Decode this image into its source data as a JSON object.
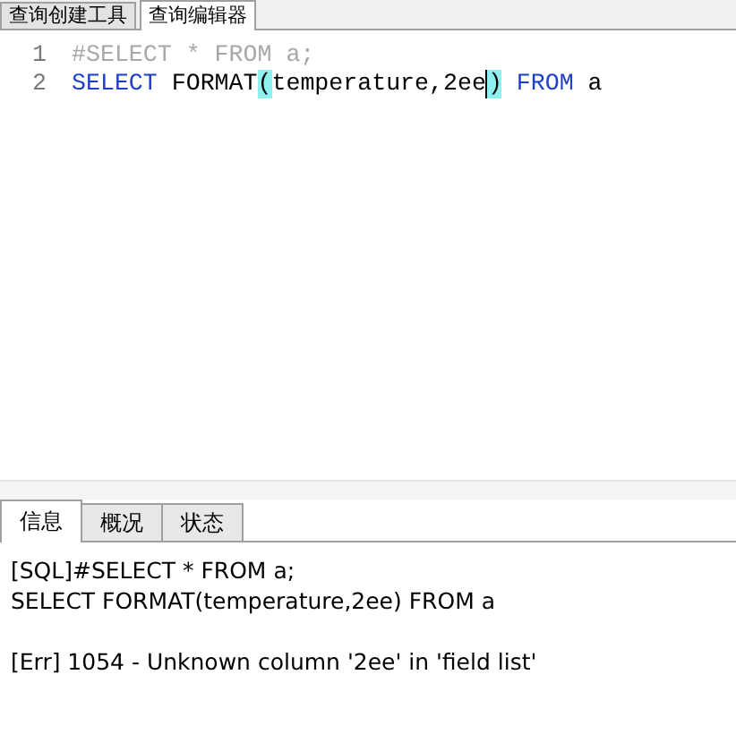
{
  "top_tabs": [
    {
      "label": "查询创建工具",
      "selected": false
    },
    {
      "label": "查询编辑器",
      "selected": true
    }
  ],
  "editor": {
    "lines": [
      {
        "number": "1",
        "tokens": [
          {
            "kind": "comment",
            "text": "#SELECT * FROM a;"
          }
        ]
      },
      {
        "number": "2",
        "tokens": [
          {
            "kind": "keyword",
            "text": "SELECT"
          },
          {
            "kind": "plain",
            "text": " FORMAT"
          },
          {
            "kind": "bracket_match",
            "text": "("
          },
          {
            "kind": "plain",
            "text": "temperature,2ee"
          },
          {
            "kind": "cursor"
          },
          {
            "kind": "bracket_match",
            "text": ")"
          },
          {
            "kind": "keyword",
            "text": " FROM"
          },
          {
            "kind": "plain",
            "text": " a"
          }
        ]
      }
    ]
  },
  "bottom_tabs": [
    {
      "label": "信息",
      "selected": true
    },
    {
      "label": "概况",
      "selected": false
    },
    {
      "label": "状态",
      "selected": false
    }
  ],
  "messages": [
    {
      "lines": [
        "[SQL]#SELECT * FROM a;",
        "SELECT FORMAT(temperature,2ee) FROM a"
      ]
    },
    {
      "lines": [
        "[Err] 1054 - Unknown column '2ee' in 'field list'"
      ]
    }
  ]
}
